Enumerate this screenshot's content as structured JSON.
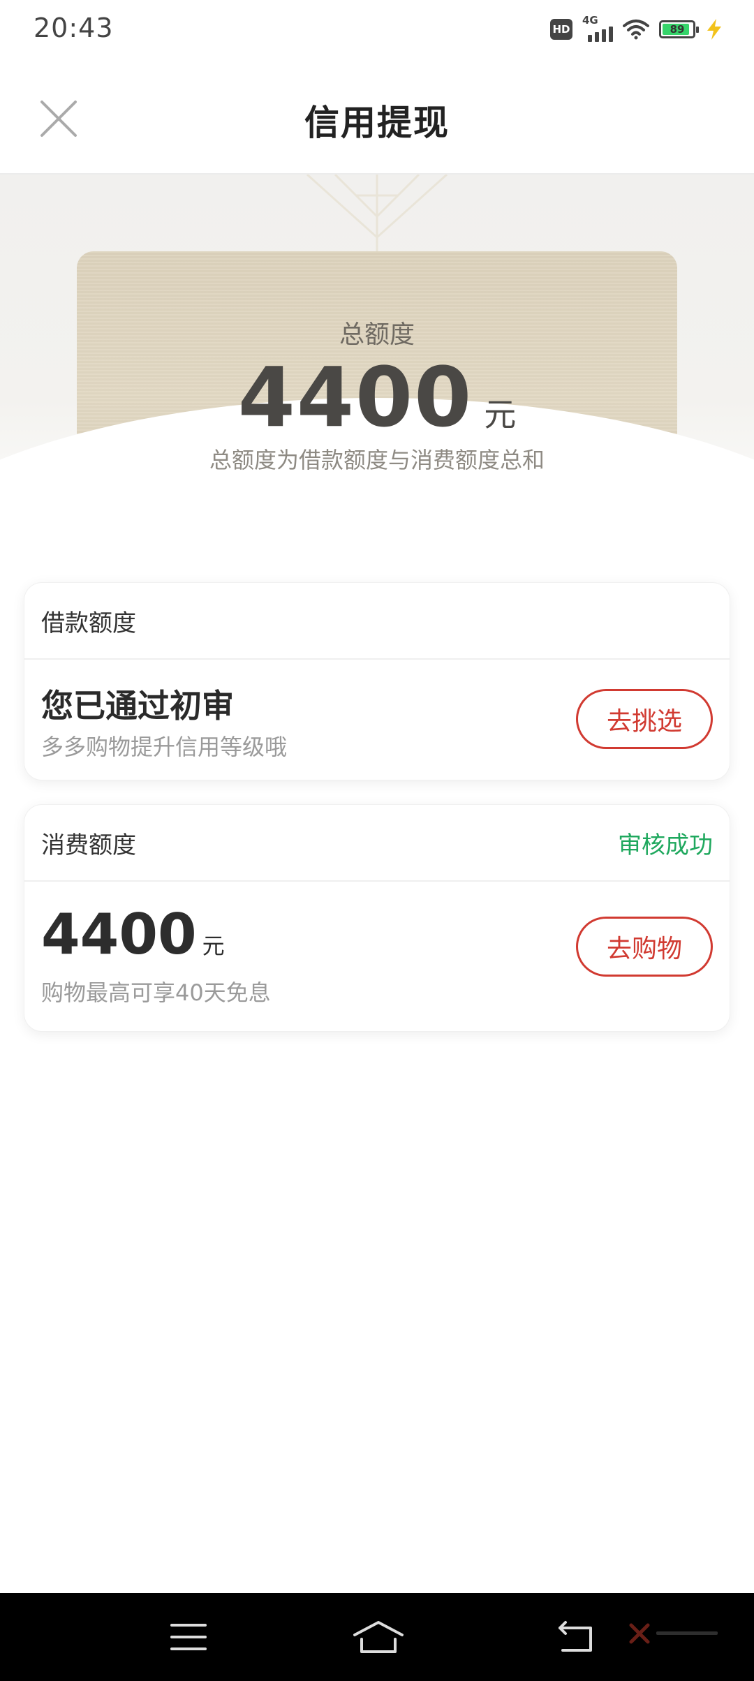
{
  "status_bar": {
    "time": "20:43",
    "hd_label": "HD",
    "network_label": "4G",
    "battery_level": "89",
    "icons": [
      "hd-icon",
      "signal-icon",
      "wifi-icon",
      "battery-icon",
      "charging-icon"
    ]
  },
  "header": {
    "title": "信用提现",
    "close_icon": "close-icon"
  },
  "hero": {
    "label": "总额度",
    "amount": "4400",
    "unit": "元",
    "description": "总额度为借款额度与消费额度总和"
  },
  "loan_card": {
    "title": "借款额度",
    "main_text": "您已通过初审",
    "sub_text": "多多购物提升信用等级哦",
    "button_label": "去挑选"
  },
  "consumption_card": {
    "title": "消费额度",
    "status": "审核成功",
    "amount": "4400",
    "unit": "元",
    "sub_text": "购物最高可享40天免息",
    "button_label": "去购物"
  },
  "nav_bar": {
    "icons": [
      "menu-icon",
      "home-icon",
      "back-icon"
    ]
  },
  "colors": {
    "accent_red": "#d13a31",
    "success_green": "#1fa85e",
    "gold_card": "#ddd3bd"
  }
}
